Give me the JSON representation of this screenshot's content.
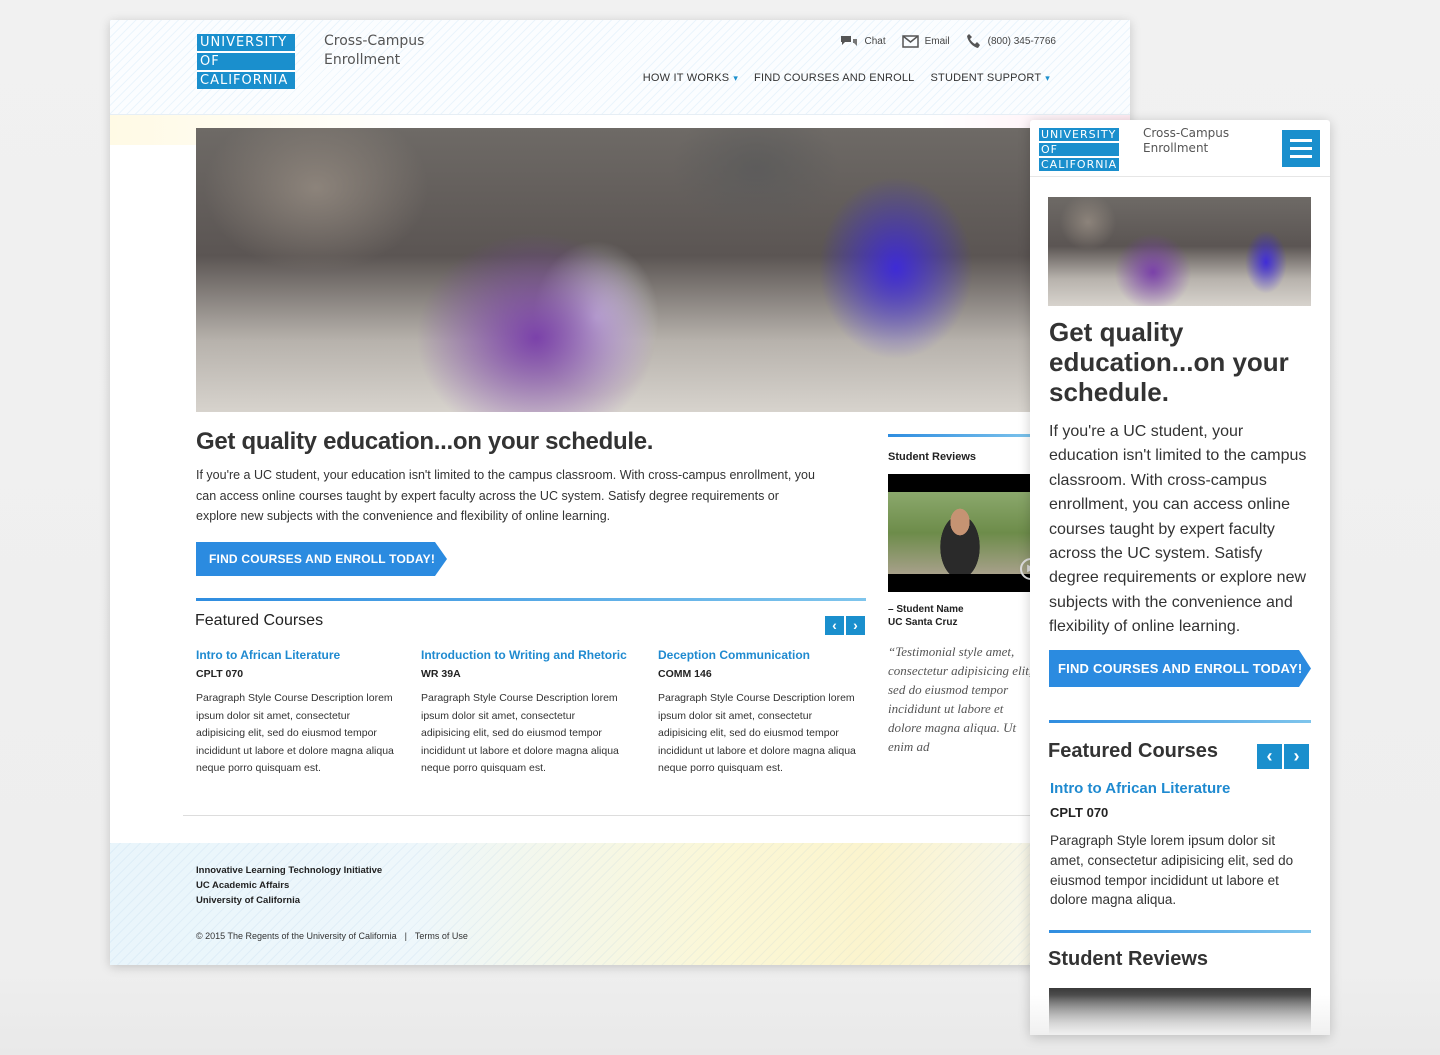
{
  "brand": {
    "logo_lines": [
      "UNIVERSITY",
      "OF",
      "CALIFORNIA"
    ],
    "site_title_line1": "Cross-Campus",
    "site_title_line2": "Enrollment",
    "accent_color": "#1a8fcd",
    "cta_color": "#2b8be0"
  },
  "utility": {
    "chat": "Chat",
    "email": "Email",
    "phone": "(800) 345-7766"
  },
  "nav": {
    "how_it_works": "HOW IT WORKS",
    "find_courses": "FIND COURSES AND ENROLL",
    "student_support": "STUDENT SUPPORT"
  },
  "main": {
    "headline": "Get quality education...on your schedule.",
    "intro": "If you're a UC student, your education isn't limited to the campus classroom. With cross-campus enrollment, you can access online courses taught by expert faculty across the UC system. Satisfy degree requirements or explore new subjects with the convenience and flexibility of online learning.",
    "cta": "FIND COURSES AND ENROLL TODAY!",
    "featured_title": "Featured Courses",
    "courses": [
      {
        "title": "Intro to African Literature",
        "code": "CPLT 070",
        "desc": "Paragraph Style Course Description lorem ipsum dolor sit amet, consectetur adipisicing elit, sed do eiusmod tempor incididunt ut labore et dolore magna aliqua neque porro quisquam est."
      },
      {
        "title": "Introduction to Writing and Rhetoric",
        "code": "WR 39A",
        "desc": "Paragraph Style Course Description lorem ipsum dolor sit amet, consectetur adipisicing elit, sed do eiusmod tempor incididunt ut labore et dolore magna aliqua neque porro quisquam est."
      },
      {
        "title": "Deception Communication",
        "code": "COMM 146",
        "desc": "Paragraph Style Course Description lorem ipsum dolor sit amet, consectetur adipisicing elit, sed do eiusmod tempor incididunt ut labore et dolore magna aliqua neque porro quisquam est."
      }
    ]
  },
  "reviews": {
    "title": "Student Reviews",
    "student_name": "– Student Name",
    "campus": "UC Santa Cruz",
    "quote": "“Testimonial style amet, consectetur adipisicing elit, sed do eiusmod tempor incididunt ut labore et dolore magna aliqua. Ut enim ad"
  },
  "footer": {
    "line1": "Innovative Learning Technology Initiative",
    "line2": "UC Academic Affairs",
    "line3": "University of California",
    "copyright": "© 2015 The Regents of the University of California",
    "separator": "|",
    "terms": "Terms of Use"
  },
  "mobile": {
    "headline": "Get quality education...on your schedule.",
    "intro": "If you're a UC student, your education isn't limited to the campus classroom. With cross-campus enrollment, you can access online courses taught by expert faculty across the UC system. Satisfy degree requirements or explore new subjects with the convenience and flexibility of online learning.",
    "cta": "FIND COURSES AND ENROLL TODAY!",
    "featured_title": "Featured Courses",
    "course_title": "Intro to African Literature",
    "course_code": "CPLT 070",
    "course_desc": "Paragraph Style lorem ipsum dolor sit amet, consectetur adipisicing elit, sed do eiusmod tempor incididunt ut labore et dolore magna aliqua.",
    "reviews_title": "Student Reviews"
  },
  "icons": {
    "chat": "chat-bubbles-icon",
    "email": "envelope-icon",
    "phone": "phone-icon",
    "prev": "chevron-left-icon",
    "next": "chevron-right-icon",
    "menu": "hamburger-menu-icon",
    "play": "play-icon",
    "caret": "chevron-down-icon"
  }
}
